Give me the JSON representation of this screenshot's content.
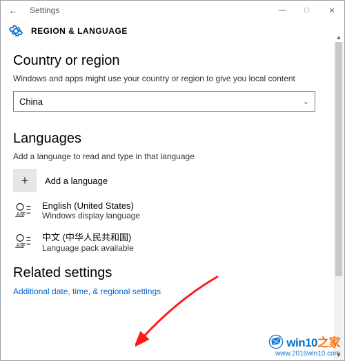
{
  "titlebar": {
    "app_name": "Settings"
  },
  "header": {
    "title": "REGION & LANGUAGE"
  },
  "region": {
    "heading": "Country or region",
    "description": "Windows and apps might use your country or region to give you local content",
    "selected": "China"
  },
  "languages": {
    "heading": "Languages",
    "description": "Add a language to read and type in that language",
    "add_label": "Add a language",
    "items": [
      {
        "name": "English (United States)",
        "note": "Windows display language"
      },
      {
        "name": "中文 (中华人民共和国)",
        "note": "Language pack available"
      }
    ]
  },
  "related": {
    "heading": "Related settings",
    "link": "Additional date, time, & regional settings"
  },
  "watermark": {
    "brand": "win10之家",
    "url": "www.2016win10.com"
  }
}
